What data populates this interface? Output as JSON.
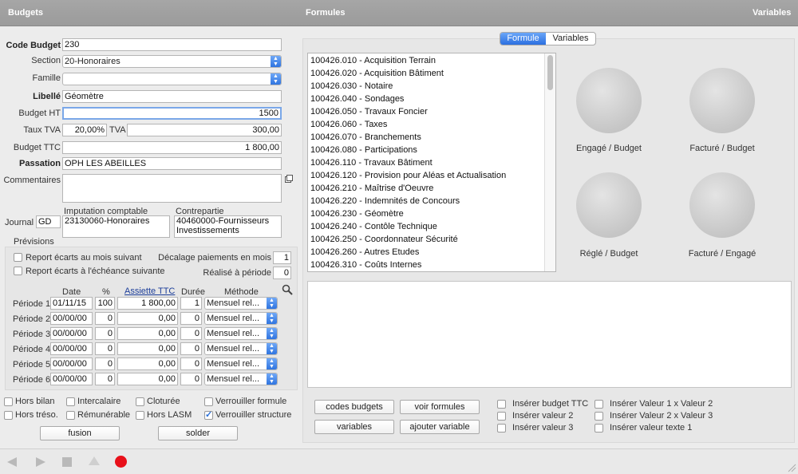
{
  "header": {
    "budgets": "Budgets",
    "formules": "Formules",
    "variables": "Variables"
  },
  "form": {
    "code_budget": {
      "label": "Code Budget",
      "value": "230"
    },
    "section": {
      "label": "Section",
      "value": "20-Honoraires"
    },
    "famille": {
      "label": "Famille",
      "value": ""
    },
    "libelle": {
      "label": "Libellé",
      "value": "Géomètre"
    },
    "budget_ht": {
      "label": "Budget HT",
      "value": "1500"
    },
    "taux_tva": {
      "label": "Taux TVA",
      "value": "20,00%",
      "tva_label": "TVA",
      "tva_value": "300,00"
    },
    "budget_ttc": {
      "label": "Budget TTC",
      "value": "1 800,00"
    },
    "passation": {
      "label": "Passation",
      "value": "OPH LES ABEILLES"
    },
    "commentaires": {
      "label": "Commentaires",
      "value": ""
    },
    "imputation": {
      "label": "Imputation comptable",
      "value": "23130060-Honoraires"
    },
    "contrepartie": {
      "label": "Contrepartie",
      "value": "40460000-Fournisseurs Investissements"
    },
    "journal": {
      "label": "Journal",
      "value": "GD"
    }
  },
  "previsions": {
    "title": "Prévisions",
    "report_mois": "Report écarts au mois suivant",
    "report_echeance": "Report écarts à l'échéance suivante",
    "decalage_label": "Décalage paiements en mois",
    "decalage_value": "1",
    "realise_label": "Réalisé à période",
    "realise_value": "0",
    "col_date": "Date",
    "col_pct": "%",
    "col_assiette": "Assiette TTC",
    "col_duree": "Durée",
    "col_methode": "Méthode",
    "rows": [
      {
        "label": "Période 1",
        "date": "01/11/15",
        "pct": "100",
        "amount": "1 800,00",
        "duree": "1",
        "methode": "Mensuel rel..."
      },
      {
        "label": "Période 2",
        "date": "00/00/00",
        "pct": "0",
        "amount": "0,00",
        "duree": "0",
        "methode": "Mensuel rel..."
      },
      {
        "label": "Période 3",
        "date": "00/00/00",
        "pct": "0",
        "amount": "0,00",
        "duree": "0",
        "methode": "Mensuel rel..."
      },
      {
        "label": "Période 4",
        "date": "00/00/00",
        "pct": "0",
        "amount": "0,00",
        "duree": "0",
        "methode": "Mensuel rel..."
      },
      {
        "label": "Période 5",
        "date": "00/00/00",
        "pct": "0",
        "amount": "0,00",
        "duree": "0",
        "methode": "Mensuel rel..."
      },
      {
        "label": "Période 6",
        "date": "00/00/00",
        "pct": "0",
        "amount": "0,00",
        "duree": "0",
        "methode": "Mensuel rel..."
      }
    ]
  },
  "options": {
    "hors_bilan": "Hors bilan",
    "intercalaire": "Intercalaire",
    "cloturee": "Cloturée",
    "verrouiller_formule": "Verrouiller formule",
    "hors_treso": "Hors tréso.",
    "remunerable": "Rémunérable",
    "hors_lasm": "Hors LASM",
    "verrouiller_structure": "Verrouiller structure",
    "verrouiller_structure_checked": true
  },
  "buttons": {
    "fusion": "fusion",
    "solder": "solder"
  },
  "tabs": {
    "formule": "Formule",
    "variables": "Variables"
  },
  "formula_list": [
    "100426.010 - Acquisition Terrain",
    "100426.020 - Acquisition Bâtiment",
    "100426.030 - Notaire",
    "100426.040 - Sondages",
    "100426.050 - Travaux Foncier",
    "100426.060 - Taxes",
    "100426.070 - Branchements",
    "100426.080 - Participations",
    "100426.110 - Travaux Bâtiment",
    "100426.120 - Provision pour Aléas et Actualisation",
    "100426.210 - Maîtrise d'Oeuvre",
    "100426.220 - Indemnités de Concours",
    "100426.230 - Géomètre",
    "100426.240 - Contôle Technique",
    "100426.250 - Coordonnateur Sécurité",
    "100426.260 - Autres Etudes",
    "100426.310 - Coûts Internes"
  ],
  "gauges": {
    "engage_budget": "Engagé / Budget",
    "facture_budget": "Facturé / Budget",
    "regle_budget": "Réglé / Budget",
    "facture_engage": "Facturé / Engagé"
  },
  "formula_buttons": {
    "codes_budgets": "codes budgets",
    "voir_formules": "voir formules",
    "variables": "variables",
    "ajouter_variable": "ajouter variable"
  },
  "inserts": {
    "budget_ttc": "Insérer budget TTC",
    "valeur_2": "Insérer valeur 2",
    "valeur_3": "Insérer valeur 3",
    "v1xv2": "Insérer Valeur 1 x Valeur 2",
    "v2xv3": "Insérer Valeur 2 x Valeur 3",
    "texte1": "Insérer valeur texte 1"
  }
}
